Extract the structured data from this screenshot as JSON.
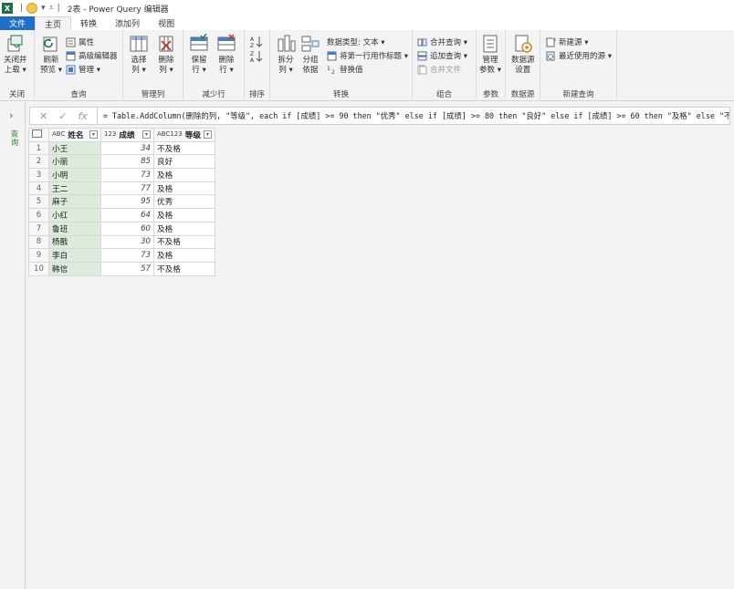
{
  "app": {
    "excel_icon": "X",
    "title": "2表 - Power Query 编辑器"
  },
  "tabs": [
    "文件",
    "主页",
    "转换",
    "添加列",
    "视图"
  ],
  "ribbon": {
    "close": {
      "btn1": "关闭并",
      "btn1b": "上载 ▾",
      "label": "关闭"
    },
    "query": {
      "refresh": "刷新",
      "refresh_b": "预览 ▾",
      "properties": "属性",
      "advanced": "高级编辑器",
      "manage": "管理 ▾",
      "label": "查询"
    },
    "manage_cols": {
      "choose": "选择",
      "choose_b": "列 ▾",
      "remove": "删除",
      "remove_b": "列 ▾",
      "label": "管理列"
    },
    "reduce_rows": {
      "keep": "保留",
      "keep_b": "行 ▾",
      "remove": "删除",
      "remove_b": "行 ▾",
      "label": "减少行"
    },
    "sort": {
      "label": "排序"
    },
    "transform": {
      "split": "拆分",
      "split_b": "列 ▾",
      "group": "分组",
      "group_b": "依据",
      "datatype": "数据类型: 文本 ▾",
      "firstrow": "将第一行用作标题 ▾",
      "replace": "替换值",
      "label": "转换"
    },
    "combine": {
      "merge": "合并查询 ▾",
      "append": "追加查询 ▾",
      "files": "合并文件",
      "label": "组合"
    },
    "params": {
      "manage": "管理",
      "manage_b": "参数 ▾",
      "label": "参数"
    },
    "datasource": {
      "settings": "数据源",
      "settings_b": "设置",
      "label": "数据源"
    },
    "newquery": {
      "newsource": "新建源 ▾",
      "recent": "最近使用的源 ▾",
      "label": "新建查询"
    }
  },
  "formula_bar": {
    "cancel": "✕",
    "confirm": "✓",
    "fx": "fx",
    "formula": "= Table.AddColumn(删除的列, \"等级\", each if [成绩] >= 90 then \"优秀\" else if [成绩] >= 80 then \"良好\" else if [成绩] >= 60 then \"及格\" else \"不及格\")"
  },
  "left_pane": {
    "label": "查询"
  },
  "table": {
    "columns": [
      {
        "type": "ABC",
        "name": "姓名"
      },
      {
        "type": "123",
        "name": "成绩"
      },
      {
        "type": "ABC123",
        "name": "等级"
      }
    ],
    "rows": [
      {
        "idx": "1",
        "name": "小王",
        "score": "34",
        "grade": "不及格"
      },
      {
        "idx": "2",
        "name": "小丽",
        "score": "85",
        "grade": "良好"
      },
      {
        "idx": "3",
        "name": "小明",
        "score": "73",
        "grade": "及格"
      },
      {
        "idx": "4",
        "name": "王二",
        "score": "77",
        "grade": "及格"
      },
      {
        "idx": "5",
        "name": "麻子",
        "score": "95",
        "grade": "优秀"
      },
      {
        "idx": "6",
        "name": "小红",
        "score": "64",
        "grade": "及格"
      },
      {
        "idx": "7",
        "name": "鲁班",
        "score": "60",
        "grade": "及格"
      },
      {
        "idx": "8",
        "name": "杨戬",
        "score": "30",
        "grade": "不及格"
      },
      {
        "idx": "9",
        "name": "李白",
        "score": "73",
        "grade": "及格"
      },
      {
        "idx": "10",
        "name": "韩信",
        "score": "57",
        "grade": "不及格"
      }
    ]
  },
  "colors": {
    "file_tab": "#1e6fc8",
    "selected_col": "#dcebdc",
    "excel_green": "#1e7145"
  }
}
